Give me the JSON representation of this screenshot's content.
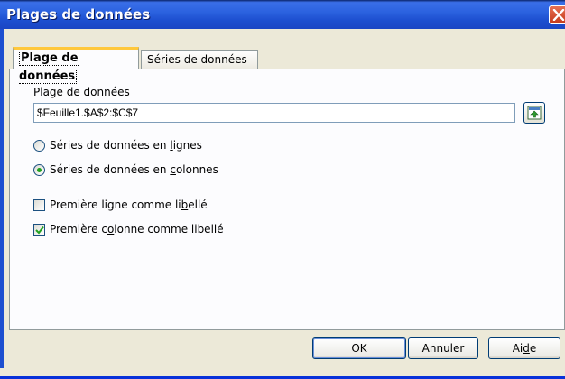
{
  "window": {
    "title": "Plages de données"
  },
  "tabs": [
    {
      "label": "Plage de données",
      "active": true
    },
    {
      "label": "Séries de données",
      "active": false
    }
  ],
  "range": {
    "label_pre": "Plage de do",
    "label_accel": "n",
    "label_post": "nées",
    "value": "$Feuille1.$A$2:$C$7"
  },
  "series": {
    "rows": {
      "pre": "Séries de données en ",
      "accel": "l",
      "post": "ignes",
      "selected": false
    },
    "cols": {
      "pre": "Séries de données en ",
      "accel": "c",
      "post": "olonnes",
      "selected": true
    }
  },
  "labels": {
    "first_row": {
      "pre": "Première ligne comme li",
      "accel": "b",
      "post": "ellé",
      "checked": false
    },
    "first_col": {
      "pre": "Première c",
      "accel": "o",
      "post": "lonne comme libellé",
      "checked": true
    }
  },
  "buttons": {
    "ok": "OK",
    "cancel": "Annuler",
    "help_pre": "Ai",
    "help_accel": "d",
    "help_post": "e"
  },
  "colors": {
    "titlebar": "#1d4fd0",
    "close": "#c4391b",
    "radio_dot": "#21a121"
  }
}
